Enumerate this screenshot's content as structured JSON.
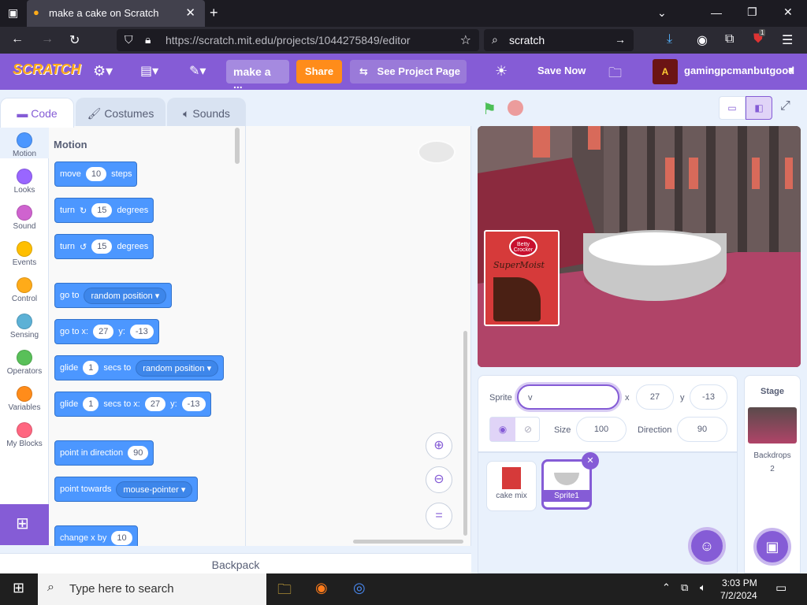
{
  "browser": {
    "tab_title": "make a cake on Scratch",
    "url": "https://scratch.mit.edu/projects/1044275849/editor",
    "search_text": "scratch",
    "ext_badge": "1"
  },
  "menubar": {
    "logo": "SCRATCH",
    "project_title": "make a ...",
    "share": "Share",
    "see_project": "See Project Page",
    "save_now": "Save Now",
    "username": "gamingpcmanbutgood"
  },
  "tabs": {
    "code": "Code",
    "costumes": "Costumes",
    "sounds": "Sounds"
  },
  "categories": [
    {
      "label": "Motion",
      "color": "#4c97ff"
    },
    {
      "label": "Looks",
      "color": "#9966ff"
    },
    {
      "label": "Sound",
      "color": "#cf63cf"
    },
    {
      "label": "Events",
      "color": "#ffbf00"
    },
    {
      "label": "Control",
      "color": "#ffab19"
    },
    {
      "label": "Sensing",
      "color": "#5cb1d6"
    },
    {
      "label": "Operators",
      "color": "#59c059"
    },
    {
      "label": "Variables",
      "color": "#ff8c1a"
    },
    {
      "label": "My Blocks",
      "color": "#ff6680"
    }
  ],
  "palette": {
    "heading": "Motion",
    "move": {
      "a": "move",
      "v": "10",
      "b": "steps"
    },
    "turn_right": {
      "a": "turn",
      "v": "15",
      "b": "degrees"
    },
    "turn_left": {
      "a": "turn",
      "v": "15",
      "b": "degrees"
    },
    "goto": {
      "a": "go to",
      "dd": "random position"
    },
    "gotoxy": {
      "a": "go to x:",
      "x": "27",
      "b": "y:",
      "y": "-13"
    },
    "glide_rand": {
      "a": "glide",
      "v": "1",
      "b": "secs to",
      "dd": "random position"
    },
    "glide_xy": {
      "a": "glide",
      "v": "1",
      "b": "secs to x:",
      "x": "27",
      "c": "y:",
      "y": "-13"
    },
    "point_dir": {
      "a": "point in direction",
      "v": "90"
    },
    "point_towards": {
      "a": "point towards",
      "dd": "mouse-pointer"
    },
    "change_x": {
      "a": "change x by",
      "v": "10"
    }
  },
  "backpack": "Backpack",
  "stage_art": {
    "box_brand": "Betty Crocker",
    "box_name": "SuperMoist"
  },
  "sprite_info": {
    "sprite_label": "Sprite",
    "sprite_name": "v",
    "x_label": "x",
    "x": "27",
    "y_label": "y",
    "y": "-13",
    "show_label": "Show",
    "size_label": "Size",
    "size": "100",
    "direction_label": "Direction",
    "direction": "90"
  },
  "sprites": [
    {
      "name": "cake mix"
    },
    {
      "name": "Sprite1"
    }
  ],
  "stage_panel": {
    "title": "Stage",
    "backdrops_label": "Backdrops",
    "backdrops_count": "2"
  },
  "taskbar": {
    "search_placeholder": "Type here to search",
    "time": "3:03 PM",
    "date": "7/2/2024"
  }
}
